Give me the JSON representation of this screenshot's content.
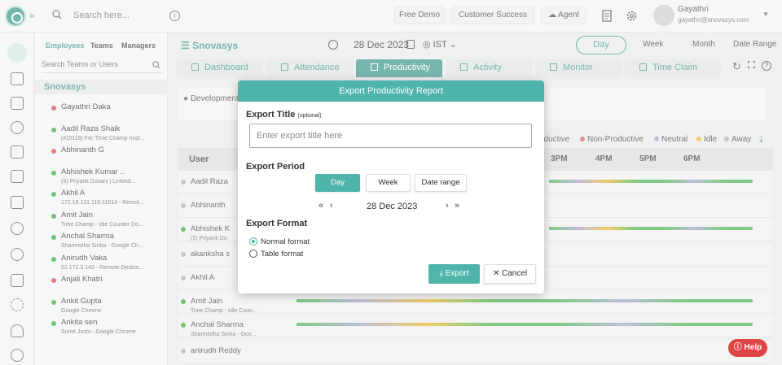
{
  "topbar": {
    "search_placeholder": "Search here...",
    "free_demo": "Free Demo",
    "customer_success": "Customer Success",
    "agent": "Agent",
    "user_name": "Gayathri",
    "user_email": "gayathri@snovasys.com"
  },
  "panel": {
    "tabs": [
      "Employees",
      "Teams",
      "Managers"
    ],
    "search_placeholder": "Search Teams or Users",
    "org": "Snovasys",
    "employees": [
      {
        "name": "Gayathri Daka",
        "sub": "",
        "status": "#d33"
      },
      {
        "name": "Aadil Raza Shaik",
        "sub": "[#15118] Fw: Time Champ Impl...",
        "status": "#2a2"
      },
      {
        "name": "Abhinanth G",
        "sub": "",
        "status": "#d33"
      },
      {
        "name": "Abhishek Kumar ..",
        "sub": "(5) Priyank Dosani | LinkedI...",
        "status": "#2a2"
      },
      {
        "name": "Akhil A",
        "sub": "172.16.131.116:11614 - Remot...",
        "status": "#2a2"
      },
      {
        "name": "Amit Jain",
        "sub": "Time Champ - Idle Counter Do...",
        "status": "#2a2"
      },
      {
        "name": "Anchal Sharma",
        "sub": "Sharmistha Sinha - Google Ch...",
        "status": "#2a2"
      },
      {
        "name": "Anirudh Vaka",
        "sub": "52.172.3.143 - Remote Deskto...",
        "status": "#2a2"
      },
      {
        "name": "Anjali Khatri",
        "sub": "",
        "status": "#d33"
      },
      {
        "name": "Ankit Gupta",
        "sub": "Google Chrome",
        "status": "#2a2"
      },
      {
        "name": "Ankita sen",
        "sub": "Sumit Joshi - Google Chrome",
        "status": "#2a2"
      }
    ]
  },
  "main": {
    "brand": "Snovasys",
    "date": "28 Dec 2023",
    "timezone": "IST",
    "ranges": [
      "Day",
      "Week",
      "Month",
      "Date Range"
    ],
    "tabs": [
      "Dashboard",
      "Attendance",
      "Productivity",
      "Activity",
      "Monitor",
      "Time Claim"
    ],
    "filter_chip": "Development",
    "legend": [
      {
        "label": "Productive",
        "shown": "oductive",
        "color": "#3cb043"
      },
      {
        "label": "Non-Productive",
        "shown": "Non-Productive",
        "color": "#d9534f"
      },
      {
        "label": "Neutral",
        "shown": "Neutral",
        "color": "#9e9ec8"
      },
      {
        "label": "Idle",
        "shown": "Idle",
        "color": "#e5b21a"
      },
      {
        "label": "Away",
        "shown": "Away",
        "color": "#aaa"
      }
    ],
    "grid_user_header": "User",
    "hours": [
      "3PM",
      "4PM",
      "5PM",
      "6PM"
    ],
    "rows": [
      {
        "name": "Aadil Raza",
        "sub": "",
        "dot": "#aaa"
      },
      {
        "name": "Abhinanth",
        "sub": "",
        "dot": "#aaa"
      },
      {
        "name": "Abhishek K",
        "sub": "(5) Priyank Do",
        "dot": "#2a2"
      },
      {
        "name": "akanksha s",
        "sub": "",
        "dot": "#aaa"
      },
      {
        "name": "Akhil A",
        "sub": "",
        "dot": "#aaa"
      },
      {
        "name": "Amit Jain",
        "sub": "Time Champ - Idle Coun...",
        "dot": "#2a2"
      },
      {
        "name": "Anchal Sharma",
        "sub": "Sharmistha Sinha - Goo...",
        "dot": "#2a2"
      },
      {
        "name": "anirudh Reddy",
        "sub": "",
        "dot": "#aaa"
      }
    ]
  },
  "modal": {
    "header": "Export Productivity Report",
    "title_label": "Export Title",
    "title_optional": "(optional)",
    "title_placeholder": "Enter export title here",
    "period_label": "Export Period",
    "period_buttons": [
      "Day",
      "Week",
      "Date range"
    ],
    "date": "28 Dec 2023",
    "format_label": "Export Format",
    "format_options": [
      "Normal format",
      "Table format"
    ],
    "export_btn": "Export",
    "cancel_btn": "Cancel"
  },
  "help": "Help"
}
